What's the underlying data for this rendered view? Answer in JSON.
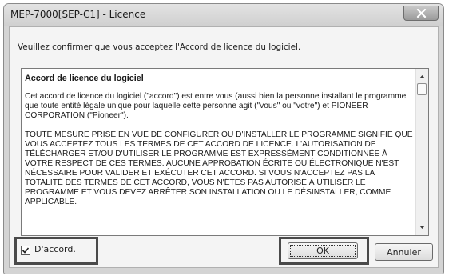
{
  "window": {
    "title": "MEP-7000[SEP-C1] - Licence"
  },
  "dialog": {
    "instruction": "Veuillez confirmer que vous acceptez l'Accord de licence du logiciel."
  },
  "license": {
    "heading": "Accord de licence du logiciel",
    "paragraphs": [
      "Cet accord de licence du logiciel (\"accord\") est entre vous (aussi bien la personne installant le programme que toute entité légale unique pour laquelle cette personne agit (\"vous\" ou \"votre\") et PIONEER CORPORATION (\"Pioneer\").",
      "TOUTE MESURE PRISE EN VUE DE CONFIGURER OU D'INSTALLER LE PROGRAMME SIGNIFIE QUE VOUS ACCEPTEZ TOUS LES TERMES DE CET ACCORD DE LICENCE. L'AUTORISATION DE TÉLÉCHARGER ET/OU D'UTILISER LE PROGRAMME EST EXPRESSÉMENT CONDITIONNÉE À VOTRE RESPECT DE CES TERMES. AUCUNE APPROBATION ÉCRITE OU ÉLECTRONIQUE N'EST NÉCESSAIRE POUR VALIDER ET EXÉCUTER CET ACCORD. SI VOUS N'ACCEPTEZ PAS LA TOTALITÉ DES TERMES DE CET ACCORD, VOUS N'ÊTES PAS AUTORISÉ À UTILISER LE PROGRAMME ET VOUS DEVEZ ARRÊTER SON INSTALLATION OU LE DÉSINSTALLER, COMME APPLICABLE."
    ]
  },
  "footer": {
    "agree_label": "D'accord.",
    "agree_checked": true,
    "ok_label": "OK",
    "cancel_label": "Annuler"
  }
}
